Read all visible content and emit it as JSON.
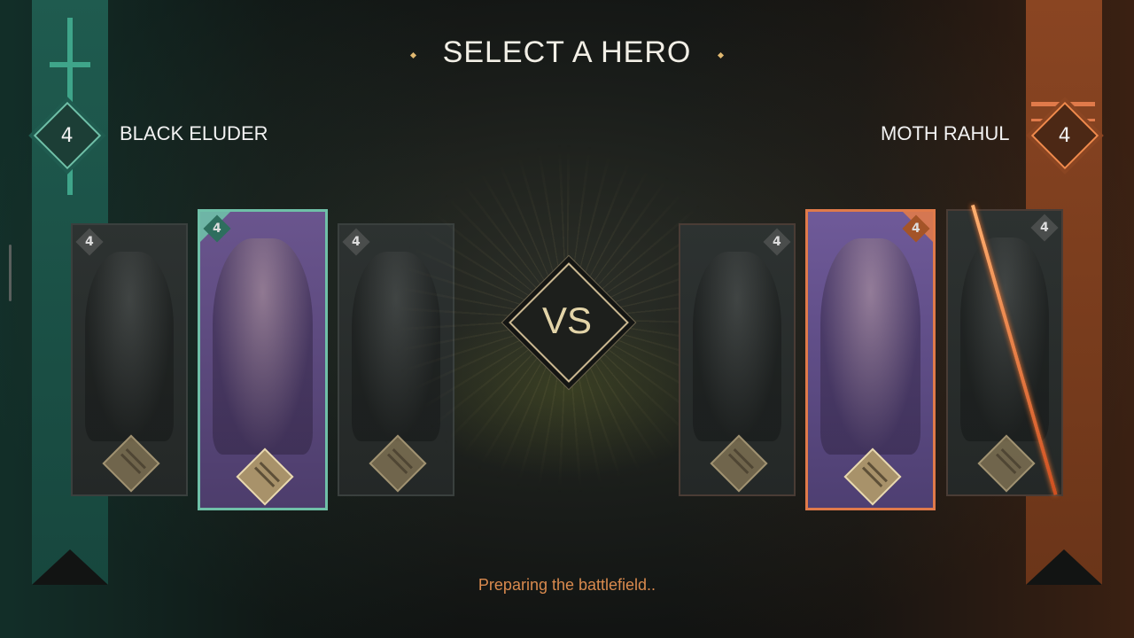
{
  "header": {
    "title": "SELECT A HERO"
  },
  "players": {
    "left": {
      "name": "BLACK ELUDER",
      "level": "4",
      "color": "#6fc0a8"
    },
    "right": {
      "name": "MOTH RAHUL",
      "level": "4",
      "color": "#e07a4a"
    }
  },
  "heroes": {
    "left": [
      {
        "level": "4",
        "selected": false
      },
      {
        "level": "4",
        "selected": true
      },
      {
        "level": "4",
        "selected": false
      }
    ],
    "right": [
      {
        "level": "4",
        "selected": false
      },
      {
        "level": "4",
        "selected": true
      },
      {
        "level": "4",
        "selected": false
      }
    ]
  },
  "versus": {
    "label": "VS"
  },
  "status": {
    "message": "Preparing the battlefield.."
  },
  "icons": {
    "left_banner": "sword-icon",
    "right_banner": "torii-gate-icon",
    "hero_class": "class-emblem-icon"
  },
  "colors": {
    "team_left": "#1f5b4f",
    "team_right": "#8a4522",
    "accent_gold": "#e3d4a8",
    "status_text": "#d98a4e"
  }
}
